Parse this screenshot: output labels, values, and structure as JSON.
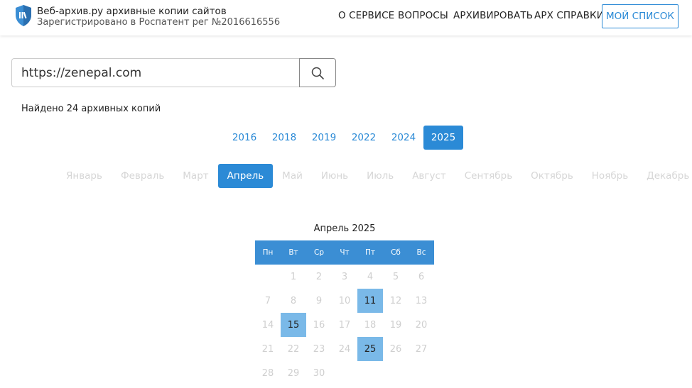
{
  "header": {
    "brand_title": "Веб-архив.ру архивные копии сайтов",
    "brand_subtitle": "Зарегистрировано в Роспатент рег №2016616556",
    "nav": {
      "about": "О СЕРВИСЕ",
      "faq": "ВОПРОСЫ",
      "archive": "АРХИВИРОВАТЬ",
      "ref": "АРХ СПРАВКИ",
      "my_list": "МОЙ СПИСОК"
    },
    "logo_icon": "shield-logo-icon"
  },
  "search": {
    "value": "https://zenepal.com",
    "icon": "search-icon"
  },
  "results": {
    "found_text": "Найдено 24 архивных копий"
  },
  "years": {
    "items": [
      "2016",
      "2018",
      "2019",
      "2022",
      "2024",
      "2025"
    ],
    "selected": "2025"
  },
  "months": {
    "items": [
      "Январь",
      "Февраль",
      "Март",
      "Апрель",
      "Май",
      "Июнь",
      "Июль",
      "Август",
      "Сентябрь",
      "Октябрь",
      "Ноябрь",
      "Декабрь"
    ],
    "selected": "Апрель"
  },
  "calendar": {
    "title": "Апрель 2025",
    "weekdays": [
      "Пн",
      "Вт",
      "Ср",
      "Чт",
      "Пт",
      "Сб",
      "Вс"
    ],
    "weeks": [
      [
        "",
        "1",
        "2",
        "3",
        "4",
        "5",
        "6"
      ],
      [
        "7",
        "8",
        "9",
        "10",
        "11",
        "12",
        "13"
      ],
      [
        "14",
        "15",
        "16",
        "17",
        "18",
        "19",
        "20"
      ],
      [
        "21",
        "22",
        "23",
        "24",
        "25",
        "26",
        "27"
      ],
      [
        "28",
        "29",
        "30",
        "",
        "",
        "",
        ""
      ]
    ],
    "available_days": [
      "11",
      "15",
      "25"
    ]
  },
  "colors": {
    "accent": "#2b8ad6",
    "calendar_header": "#3b8ed4",
    "available_day": "#7ab9e8",
    "disabled_text": "#d6d6d6"
  }
}
